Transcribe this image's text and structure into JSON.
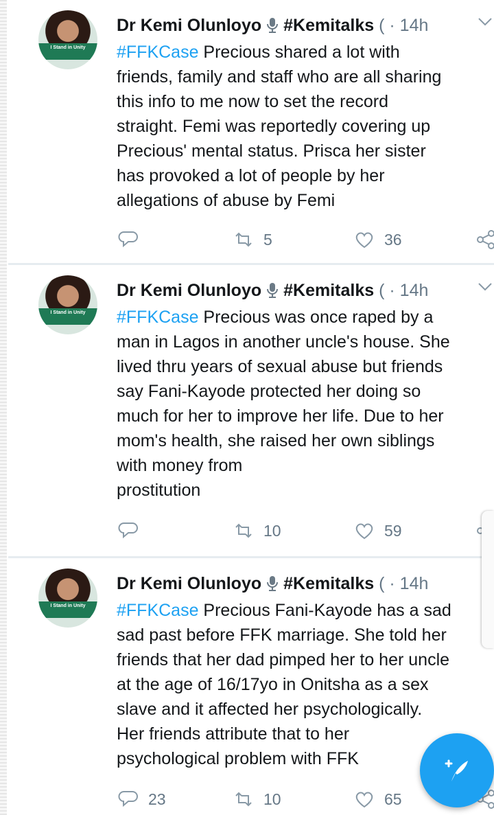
{
  "tweets": [
    {
      "author": "Dr Kemi Olunloyo",
      "handle": "#Kemitalks",
      "handle_cut": "(",
      "time": "· 14h",
      "hashtag": "#FFKCase",
      "text": " Precious shared a lot with\nfriends, family and staff who are all sharing\nthis info to me now to set the record\nstraight. Femi was reportedly covering up\nPrecious' mental status. Prisca her sister\nhas provoked a lot of people by her\nallegations of abuse by Femi",
      "replies": "",
      "retweets": "5",
      "likes": "36",
      "avatar_text": "I Stand in Unity"
    },
    {
      "author": "Dr Kemi Olunloyo",
      "handle": "#Kemitalks",
      "handle_cut": "(",
      "time": "· 14h",
      "hashtag": "#FFKCase",
      "text": " Precious was once raped by a\nman in Lagos in another uncle's house. She\nlived thru years of sexual abuse but friends\nsay Fani-Kayode protected her doing so\nmuch for her to improve her life. Due to her\nmom's health, she raised her own siblings\nwith money from\nprostitution",
      "replies": "",
      "retweets": "10",
      "likes": "59",
      "avatar_text": "I Stand in Unity"
    },
    {
      "author": "Dr Kemi Olunloyo",
      "handle": "#Kemitalks",
      "handle_cut": "(",
      "time": "· 14h",
      "hashtag": "#FFKCase",
      "text": " Precious Fani-Kayode has a sad\nsad past before FFK marriage. She told her\nfriends that her dad pimped her to her uncle\nat the age of 16/17yo in Onitsha as a sex\nslave and it affected her psychologically.\nHer friends attribute that to her\npsychological problem with FFK",
      "replies": "23",
      "retweets": "10",
      "likes": "65",
      "avatar_text": "I Stand in Unity"
    }
  ],
  "colors": {
    "link": "#1da1f2",
    "text": "#14171a",
    "muted": "#657786",
    "divider": "#e6ecf0",
    "avatar_banner": "#1f7a55"
  },
  "icons": {
    "reply": "reply-icon",
    "retweet": "retweet-icon",
    "like": "heart-icon",
    "share": "share-icon",
    "menu": "chevron-down-icon",
    "verified": "microphone-icon",
    "compose": "compose-tweet-icon"
  }
}
